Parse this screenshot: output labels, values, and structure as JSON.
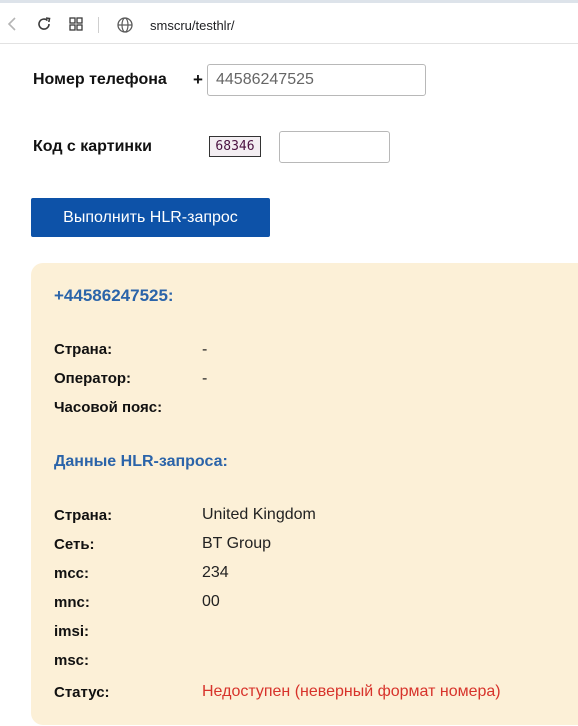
{
  "browser": {
    "url": "smscru/testhlr/"
  },
  "form": {
    "phone_label": "Номер телефона",
    "phone_prefix": "+",
    "phone_value": "44586247525",
    "captcha_label": "Код с картинки",
    "captcha_text": "68346",
    "captcha_value": "",
    "submit_label": "Выполнить HLR-запрос"
  },
  "result": {
    "number": "+44586247525:",
    "basic": {
      "country_label": "Страна:",
      "country_value": "-",
      "operator_label": "Оператор:",
      "operator_value": "-",
      "timezone_label": "Часовой пояс:",
      "timezone_value": ""
    },
    "hlr_title": "Данные HLR-запроса:",
    "hlr": {
      "country_label": "Страна:",
      "country_value": "United Kingdom",
      "network_label": "Сеть:",
      "network_value": "BT Group",
      "mcc_label": "mcc:",
      "mcc_value": "234",
      "mnc_label": "mnc:",
      "mnc_value": "00",
      "imsi_label": "imsi:",
      "imsi_value": "",
      "msc_label": "msc:",
      "msc_value": "",
      "status_label": "Статус:",
      "status_value": "Недоступен (неверный формат номера)"
    }
  },
  "colors": {
    "button": "#0d52a8",
    "link_heading": "#2b64a9",
    "card_background": "#fcf0d7",
    "status_error": "#d7332b"
  }
}
